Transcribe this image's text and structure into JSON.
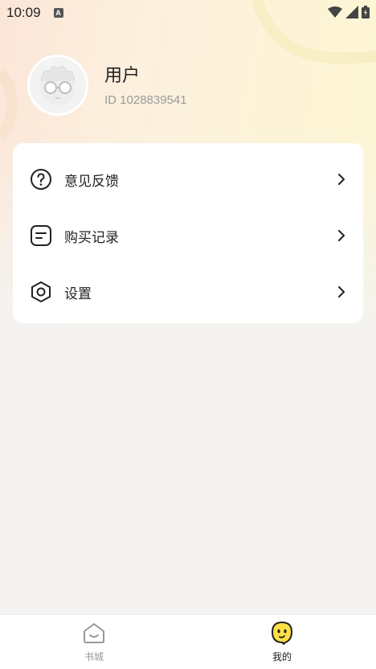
{
  "status_bar": {
    "time": "10:09",
    "notification_letter": "A"
  },
  "profile": {
    "name": "用户",
    "user_id": "ID 1028839541"
  },
  "menu": {
    "items": [
      {
        "label": "意见反馈",
        "icon": "help-circle-icon"
      },
      {
        "label": "购买记录",
        "icon": "record-icon"
      },
      {
        "label": "设置",
        "icon": "settings-hexagon-icon"
      }
    ]
  },
  "tab_bar": {
    "tabs": [
      {
        "label": "书城",
        "icon": "home-icon",
        "active": false
      },
      {
        "label": "我的",
        "icon": "smiley-icon",
        "active": true
      }
    ]
  },
  "colors": {
    "active_tab": "#222222",
    "inactive_tab": "#999999",
    "accent_yellow": "#fde047"
  }
}
